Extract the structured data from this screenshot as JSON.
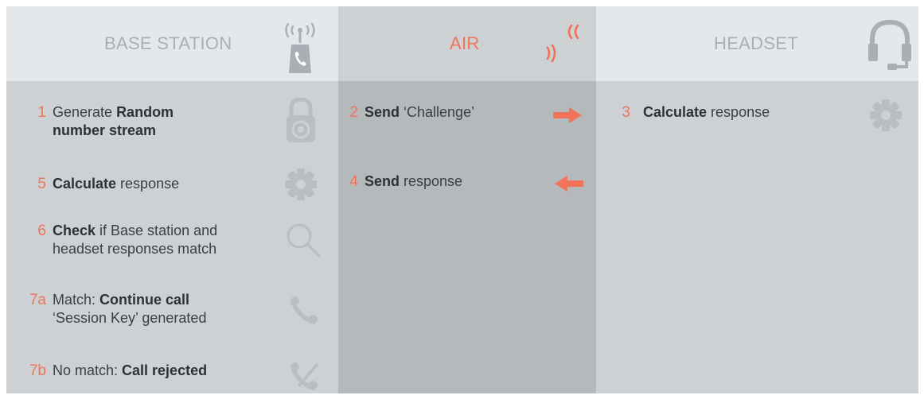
{
  "columns": {
    "base": {
      "title": "BASE STATION",
      "icon": "phone-tower-icon"
    },
    "air": {
      "title": "AIR",
      "icon": "radio-waves-icon"
    },
    "headset": {
      "title": "HEADSET",
      "icon": "headset-icon"
    }
  },
  "base_steps": [
    {
      "num": "1",
      "line1_pre": "Generate ",
      "line1_bold": "Random",
      "line1_post": "",
      "line2_pre": "",
      "line2_bold": "number stream",
      "line2_post": "",
      "icon": "padlock-icon"
    },
    {
      "num": "5",
      "line1_pre": "",
      "line1_bold": "Calculate",
      "line1_post": " response",
      "icon": "gear-icon"
    },
    {
      "num": "6",
      "line1_pre": "",
      "line1_bold": "Check",
      "line1_post": " if Base station and",
      "line2_pre": "headset responses match",
      "line2_bold": "",
      "line2_post": "",
      "icon": "magnifier-icon"
    },
    {
      "num": "7a",
      "line1_pre": "Match: ",
      "line1_bold": "Continue call",
      "line1_post": "",
      "line2_pre": "‘Session Key’ generated",
      "line2_bold": "",
      "line2_post": "",
      "icon": "phone-handset-icon"
    },
    {
      "num": "7b",
      "line1_pre": "No match: ",
      "line1_bold": "Call rejected",
      "line1_post": "",
      "icon": "phone-rejected-icon"
    }
  ],
  "air_steps": [
    {
      "num": "2",
      "bold": "Send",
      "post": " ‘Challenge’",
      "icon": "arrow-right-icon"
    },
    {
      "num": "4",
      "bold": "Send",
      "post": " response",
      "icon": "arrow-left-icon"
    }
  ],
  "headset_steps": [
    {
      "num": "3",
      "bold": "Calculate",
      "post": " response",
      "icon": "gear-icon"
    }
  ],
  "colors": {
    "accent": "#f0735a",
    "icon_grey": "#b9bec2",
    "text": "#3b3f42"
  }
}
